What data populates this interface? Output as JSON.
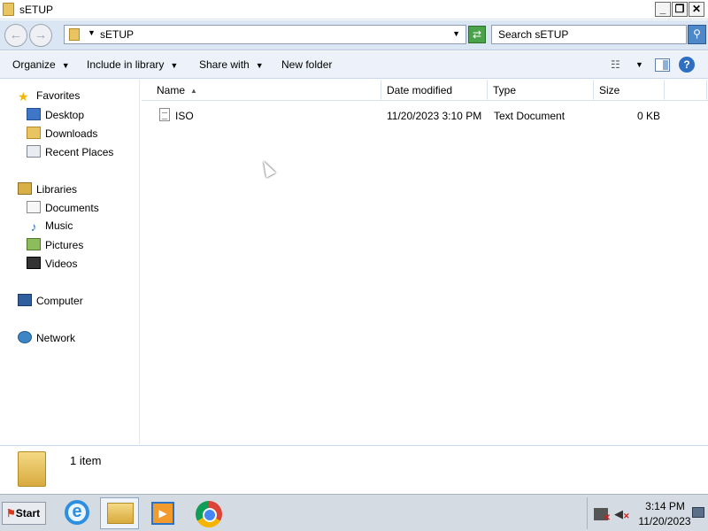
{
  "window": {
    "title": "sETUP",
    "controls": {
      "minimize": "_",
      "maximize": "❐",
      "close": "✕"
    }
  },
  "address": {
    "crumb": "sETUP",
    "search_placeholder": "Search sETUP"
  },
  "toolbar": {
    "organize": "Organize",
    "include": "Include in library",
    "share": "Share with",
    "new_folder": "New folder"
  },
  "nav": {
    "favorites": {
      "label": "Favorites",
      "items": [
        "Desktop",
        "Downloads",
        "Recent Places"
      ]
    },
    "libraries": {
      "label": "Libraries",
      "items": [
        "Documents",
        "Music",
        "Pictures",
        "Videos"
      ]
    },
    "computer": "Computer",
    "network": "Network"
  },
  "columns": {
    "name": "Name",
    "date": "Date modified",
    "type": "Type",
    "size": "Size"
  },
  "files": [
    {
      "name": "ISO",
      "date": "11/20/2023 3:10 PM",
      "type": "Text Document",
      "size": "0 KB"
    }
  ],
  "details": {
    "count": "1 item"
  },
  "taskbar": {
    "start": "Start",
    "time": "3:14 PM",
    "date": "11/20/2023"
  },
  "colors": {
    "accent": "#2f6fbf",
    "toolbar_bg": "#edf2fa",
    "address_bg": "#dbe6f4",
    "taskbar_bg": "#d5dbe3"
  },
  "icons": [
    "folder-icon",
    "back-icon",
    "forward-icon",
    "refresh-icon",
    "search-icon",
    "views-icon",
    "preview-pane-icon",
    "help-icon",
    "star-icon",
    "desktop-icon",
    "downloads-icon",
    "recent-places-icon",
    "libraries-icon",
    "documents-icon",
    "music-icon",
    "pictures-icon",
    "videos-icon",
    "computer-icon",
    "network-icon",
    "text-file-icon",
    "internet-explorer-icon",
    "windows-explorer-icon",
    "media-player-icon",
    "chrome-icon",
    "network-status-icon",
    "volume-icon"
  ]
}
